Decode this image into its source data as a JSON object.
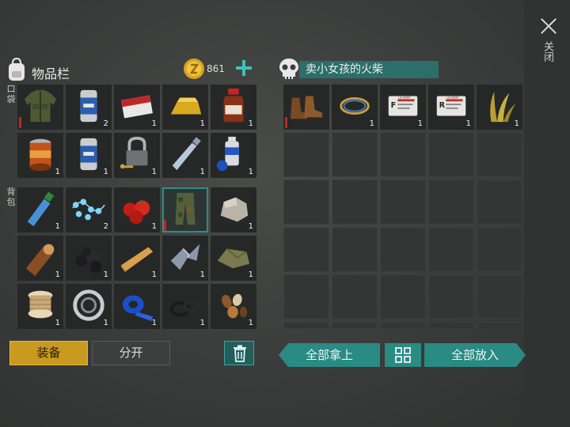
{
  "inventory": {
    "title": "物品栏",
    "coins": "861",
    "pocket_label": "口袋",
    "backpack_label": "背包",
    "pocket_slots": [
      {
        "item": "military-jacket-icon",
        "qty": "",
        "wear": true
      },
      {
        "item": "beer-can-icon",
        "qty": "2"
      },
      {
        "item": "cigarette-pack-icon",
        "qty": "1"
      },
      {
        "item": "gold-bar-icon",
        "qty": "1"
      },
      {
        "item": "medicine-bottle-icon",
        "qty": "1"
      },
      {
        "item": "canned-food-icon",
        "qty": "1"
      },
      {
        "item": "beer-can-icon",
        "qty": "1"
      },
      {
        "item": "padlock-key-icon",
        "qty": "1"
      },
      {
        "item": "plastic-bottle-icon",
        "qty": "1"
      },
      {
        "item": "spray-can-icon",
        "qty": "1"
      }
    ],
    "backpack_slots": [
      {
        "item": "water-bottle-icon",
        "qty": "1"
      },
      {
        "item": "string-lights-icon",
        "qty": "2"
      },
      {
        "item": "tomatoes-icon",
        "qty": "1"
      },
      {
        "item": "camo-pants-icon",
        "qty": "",
        "wear": true,
        "selected": true
      },
      {
        "item": "stone-icon",
        "qty": "1"
      },
      {
        "item": "wood-log-icon",
        "qty": "1"
      },
      {
        "item": "coal-icon",
        "qty": "1"
      },
      {
        "item": "wood-plank-icon",
        "qty": "1"
      },
      {
        "item": "metal-scrap-icon",
        "qty": "1"
      },
      {
        "item": "cloth-scrap-icon",
        "qty": "1"
      },
      {
        "item": "thread-spool-icon",
        "qty": "1"
      },
      {
        "item": "bearing-icon",
        "qty": "1"
      },
      {
        "item": "tape-roll-icon",
        "qty": "1"
      },
      {
        "item": "rubber-rings-icon",
        "qty": "1"
      },
      {
        "item": "seeds-icon",
        "qty": "1"
      }
    ]
  },
  "loot": {
    "title": "卖小女孩的火柴",
    "slots": [
      {
        "item": "leather-boots-icon",
        "qty": "",
        "wear": true
      },
      {
        "item": "wire-coil-icon",
        "qty": "1"
      },
      {
        "item": "army-card-f-icon",
        "qty": "1",
        "letter": "F"
      },
      {
        "item": "army-card-r-icon",
        "qty": "1",
        "letter": "R"
      },
      {
        "item": "grass-icon",
        "qty": "1"
      }
    ],
    "card_text": "US ARMY"
  },
  "buttons": {
    "equip": "装备",
    "split": "分开",
    "take_all": "全部拿上",
    "put_all": "全部放入"
  },
  "close_label": "关闭",
  "colors": {
    "accent": "#2a8a84",
    "gold": "#c89a20",
    "wear": "#b82820"
  }
}
